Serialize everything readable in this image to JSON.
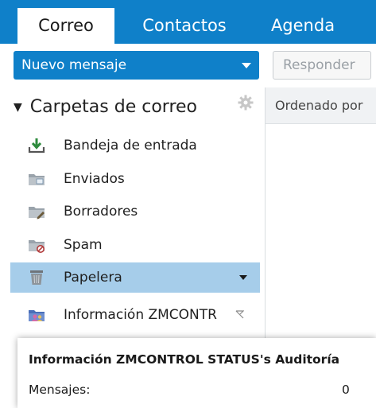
{
  "nav": {
    "tabs": [
      {
        "label": "Correo",
        "active": true
      },
      {
        "label": "Contactos",
        "active": false
      },
      {
        "label": "Agenda",
        "active": false
      }
    ]
  },
  "toolbar": {
    "new_message_label": "Nuevo mensaje",
    "reply_label": "Responder"
  },
  "sidebar": {
    "header": "Carpetas de correo",
    "header_toggle": "▼",
    "folders": [
      {
        "label": "Bandeja de entrada",
        "icon": "inbox-icon"
      },
      {
        "label": "Enviados",
        "icon": "sent-icon"
      },
      {
        "label": "Borradores",
        "icon": "drafts-icon"
      },
      {
        "label": "Spam",
        "icon": "spam-icon"
      },
      {
        "label": "Papelera",
        "icon": "trash-icon",
        "selected": true
      },
      {
        "label": "Información ZMCONTR",
        "icon": "shared-folder-icon"
      }
    ]
  },
  "list": {
    "sort_label": "Ordenado por"
  },
  "tooltip": {
    "title": "Información ZMCONTROL STATUS's Auditoría",
    "messages_label": "Mensajes:",
    "messages_value": "0"
  },
  "colors": {
    "brand": "#0f80c9",
    "selected_bg": "#a6cdea"
  }
}
